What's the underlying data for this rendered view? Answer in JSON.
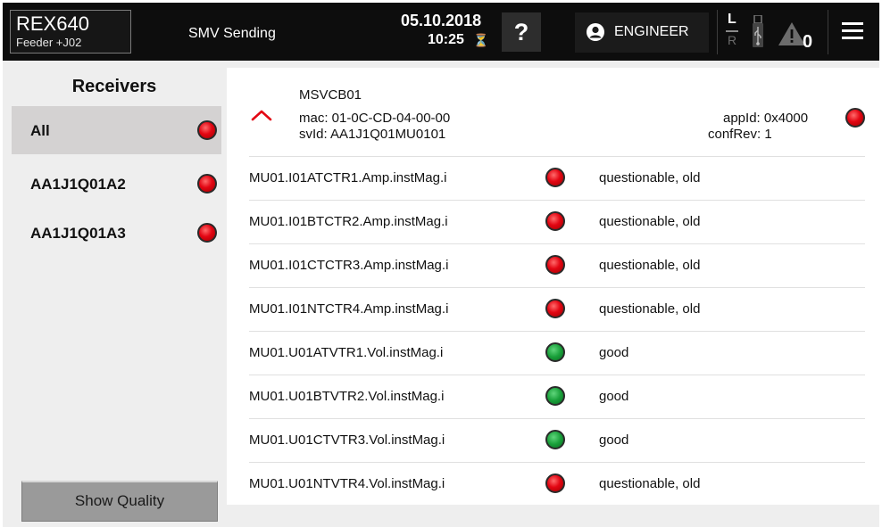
{
  "header": {
    "device_name": "REX640",
    "device_location": "Feeder +J02",
    "page_title": "SMV Sending",
    "date": "05.10.2018",
    "time": "10:25",
    "help_label": "?",
    "user_label": "ENGINEER",
    "local_label": "L",
    "remote_label": "R",
    "alarm_count": "0"
  },
  "sidebar": {
    "title": "Receivers",
    "items": [
      {
        "label": "All",
        "status": "red",
        "selected": true
      },
      {
        "label": "AA1J1Q01A2",
        "status": "red",
        "selected": false
      },
      {
        "label": "AA1J1Q01A3",
        "status": "red",
        "selected": false
      }
    ],
    "show_quality_label": "Show Quality"
  },
  "control_block": {
    "name": "MSVCB01",
    "mac": "mac:  01-0C-CD-04-00-00",
    "svid": "svId:  AA1J1Q01MU0101",
    "appid": "appId:  0x4000",
    "confrev": "confRev:  1",
    "status": "red"
  },
  "signals": [
    {
      "name": "MU01.I01ATCTR1.Amp.instMag.i",
      "status": "red",
      "quality": "questionable, old"
    },
    {
      "name": "MU01.I01BTCTR2.Amp.instMag.i",
      "status": "red",
      "quality": "questionable, old"
    },
    {
      "name": "MU01.I01CTCTR3.Amp.instMag.i",
      "status": "red",
      "quality": "questionable, old"
    },
    {
      "name": "MU01.I01NTCTR4.Amp.instMag.i",
      "status": "red",
      "quality": "questionable, old"
    },
    {
      "name": "MU01.U01ATVTR1.Vol.instMag.i",
      "status": "green",
      "quality": "good"
    },
    {
      "name": "MU01.U01BTVTR2.Vol.instMag.i",
      "status": "green",
      "quality": "good"
    },
    {
      "name": "MU01.U01CTVTR3.Vol.instMag.i",
      "status": "green",
      "quality": "good"
    },
    {
      "name": "MU01.U01NTVTR4.Vol.instMag.i",
      "status": "red",
      "quality": "questionable, old"
    }
  ],
  "colors": {
    "topbar": "#0d0d0d",
    "led_red": "#e30613",
    "led_green": "#19a03a",
    "accent_red": "#e30613"
  },
  "icons": {
    "time_sync": "clock-unsynced-icon",
    "user": "user-icon",
    "usb": "usb-icon",
    "alarm": "warning-icon",
    "menu": "hamburger-menu-icon",
    "collapse": "chevron-up-icon"
  }
}
